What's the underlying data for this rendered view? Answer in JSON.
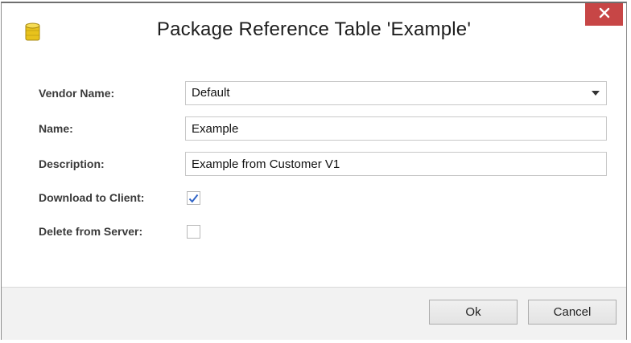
{
  "dialog": {
    "title": "Package Reference Table 'Example'"
  },
  "form": {
    "vendor": {
      "label": "Vendor Name:",
      "value": "Default"
    },
    "name": {
      "label": "Name:",
      "value": "Example"
    },
    "description": {
      "label": "Description:",
      "value": "Example from Customer V1"
    },
    "download": {
      "label": "Download to Client:",
      "checked": true
    },
    "delete": {
      "label": "Delete from Server:",
      "checked": false
    }
  },
  "buttons": {
    "ok": "Ok",
    "cancel": "Cancel"
  },
  "icons": {
    "app": "database-icon",
    "close": "close-icon",
    "dropdown": "chevron-down-icon",
    "check": "checkmark-icon"
  },
  "colors": {
    "close_button": "#c74646",
    "checkmark": "#2f63c7"
  }
}
